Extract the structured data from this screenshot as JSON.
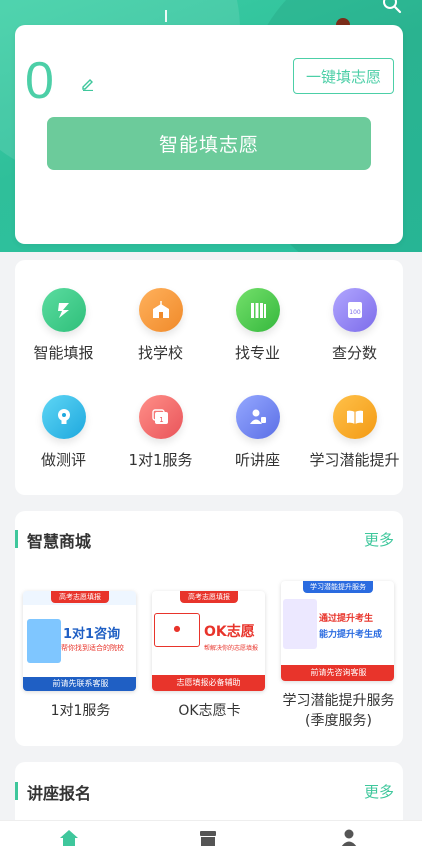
{
  "colors": {
    "accent": "#3fc79c",
    "score": "#4ccfa7",
    "smart_button": "#6ccb9b"
  },
  "hero": {
    "score": "0",
    "quick_fill_label": "一键填志愿",
    "smart_fill_label": "智能填志愿",
    "icons": [
      "search-icon",
      "edit-icon"
    ]
  },
  "grid": {
    "items": [
      {
        "label": "智能填报",
        "icon": "magic-fill-icon",
        "color": "#3ecf8e"
      },
      {
        "label": "找学校",
        "icon": "school-icon",
        "color": "#f59a3c"
      },
      {
        "label": "找专业",
        "icon": "books-icon",
        "color": "#49c951"
      },
      {
        "label": "查分数",
        "icon": "score-card-icon",
        "color": "#8f7ff0"
      },
      {
        "label": "做测评",
        "icon": "lightbulb-icon",
        "color": "#2bbde8"
      },
      {
        "label": "1对1服务",
        "icon": "service-icon",
        "color": "#f0676a"
      },
      {
        "label": "听讲座",
        "icon": "lecture-icon",
        "color": "#6f86f0"
      },
      {
        "label": "学习潜能提升",
        "icon": "open-book-icon",
        "color": "#f4a623"
      }
    ]
  },
  "mall": {
    "title": "智慧商城",
    "more": "更多",
    "products": [
      {
        "name": "1对1服务",
        "banner": "高考志愿填报",
        "headline": "1对1咨询",
        "sub": "帮你找到适合的院校",
        "footer": "前请先联系客服"
      },
      {
        "name": "OK志愿卡",
        "banner": "高考志愿填报",
        "headline": "OK志愿",
        "sub": "帮解决你的志愿填报",
        "footer": "志愿填报必备辅助"
      },
      {
        "name": "学习潜能提升服务(季度服务)",
        "banner": "学习潜能提升服务",
        "headline": "通过提升考生",
        "sub": "能力提升考生成",
        "footer": "前请先咨询客服"
      }
    ]
  },
  "lecture": {
    "title": "讲座报名",
    "more": "更多"
  },
  "tabbar": {
    "icons": [
      "home-icon",
      "shop-icon",
      "profile-icon"
    ]
  }
}
